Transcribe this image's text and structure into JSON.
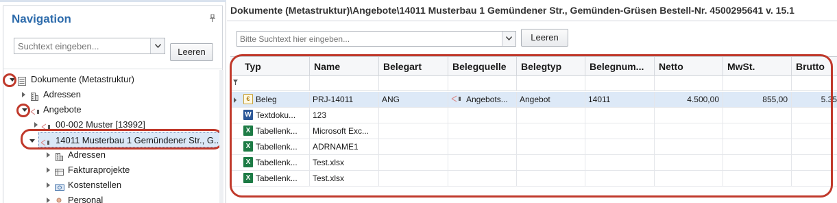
{
  "navigation": {
    "title": "Navigation",
    "pin_icon": "pin-icon",
    "search": {
      "placeholder": "Suchtext eingeben...",
      "value": ""
    },
    "clear_label": "Leeren",
    "tree": [
      {
        "label": "Dokumente (Metastruktur)",
        "icon": "document-tree-icon",
        "state": "expanded",
        "level": 0
      },
      {
        "label": "Adressen",
        "icon": "building-icon",
        "state": "collapsed",
        "level": 1
      },
      {
        "label": "Angebote",
        "icon": "offer-icon",
        "state": "expanded",
        "level": 1
      },
      {
        "label": "00-002 Muster  [13992]",
        "icon": "offer-icon",
        "state": "collapsed",
        "level": 2
      },
      {
        "label": "14011 Musterbau 1 Gemündener Str., G...",
        "icon": "offer-icon",
        "state": "expanded",
        "level": 2,
        "selected": true
      },
      {
        "label": "Adressen",
        "icon": "building-icon",
        "state": "collapsed",
        "level": 3
      },
      {
        "label": "Fakturaprojekte",
        "icon": "project-icon",
        "state": "collapsed",
        "level": 3
      },
      {
        "label": "Kostenstellen",
        "icon": "cost-center-icon",
        "state": "collapsed",
        "level": 3
      },
      {
        "label": "Personal",
        "icon": "person-icon",
        "state": "collapsed",
        "level": 3
      }
    ]
  },
  "main": {
    "path_title": "Dokumente (Metastruktur)\\Angebote\\14011 Musterbau 1 Gemündener Str., Gemünden-Grüsen Bestell-Nr. 4500295641 v. 15.1",
    "search": {
      "placeholder": "Bitte Suchtext hier eingeben...",
      "value": ""
    },
    "clear_label": "Leeren",
    "columns": [
      "Typ",
      "Name",
      "Belegart",
      "Belegquelle",
      "Belegtyp",
      "Belegnum...",
      "Netto",
      "MwSt.",
      "Brutto"
    ],
    "rows": [
      {
        "icon": "beleg-icon",
        "typ": "Beleg",
        "name": "PRJ-14011",
        "belegart": "ANG",
        "belegquelle": "Angebots...",
        "belegtyp": "Angebot",
        "belegnummer": "14011",
        "netto": "4.500,00",
        "mwst": "855,00",
        "brutto": "5.35",
        "selected": true
      },
      {
        "icon": "word-icon",
        "typ": "Textdoku...",
        "name": "123",
        "belegart": "",
        "belegquelle": "",
        "belegtyp": "",
        "belegnummer": "",
        "netto": "",
        "mwst": "",
        "brutto": ""
      },
      {
        "icon": "excel-icon",
        "typ": "Tabellenk...",
        "name": "Microsoft Exc...",
        "belegart": "",
        "belegquelle": "",
        "belegtyp": "",
        "belegnummer": "",
        "netto": "",
        "mwst": "",
        "brutto": ""
      },
      {
        "icon": "excel-icon",
        "typ": "Tabellenk...",
        "name": "ADRNAME1",
        "belegart": "",
        "belegquelle": "",
        "belegtyp": "",
        "belegnummer": "",
        "netto": "",
        "mwst": "",
        "brutto": ""
      },
      {
        "icon": "excel-icon",
        "typ": "Tabellenk...",
        "name": "Test.xlsx",
        "belegart": "",
        "belegquelle": "",
        "belegtyp": "",
        "belegnummer": "",
        "netto": "",
        "mwst": "",
        "brutto": ""
      },
      {
        "icon": "excel-icon",
        "typ": "Tabellenk...",
        "name": "Test.xlsx",
        "belegart": "",
        "belegquelle": "",
        "belegtyp": "",
        "belegnummer": "",
        "netto": "",
        "mwst": "",
        "brutto": ""
      }
    ]
  },
  "colors": {
    "accent": "#2d6bab",
    "annotation": "#c0392b",
    "selection": "#dde9f7"
  }
}
